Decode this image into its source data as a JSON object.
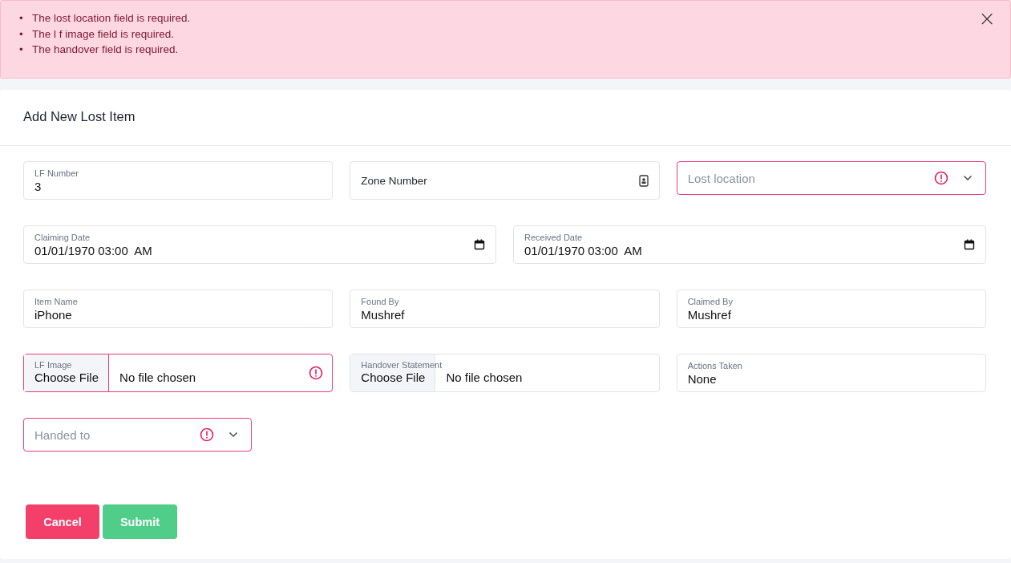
{
  "alert": {
    "messages": [
      {
        "bullet": "•",
        "text": "The lost location field is required."
      },
      {
        "bullet": "•",
        "text": "The l f image field is required."
      },
      {
        "bullet": "•",
        "text": "The handover field is required."
      }
    ],
    "close": "×"
  },
  "form": {
    "title": "Add New Lost Item",
    "rows": [
      [
        {
          "kind": "text",
          "label": "LF Number",
          "value": "3",
          "invalid": false
        },
        {
          "kind": "plain",
          "label": "Zone Number",
          "invalid": false
        },
        {
          "kind": "select",
          "placeholder": "Lost location",
          "invalid": true
        }
      ],
      [
        {
          "kind": "datetime",
          "label": "Claiming Date",
          "value": "01/01/1970 03:00  AM",
          "invalid": false
        },
        {
          "kind": "datetime",
          "label": "Received Date",
          "value": "01/01/1970 03:00  AM",
          "invalid": false
        }
      ],
      [
        {
          "kind": "text",
          "label": "Item Name",
          "value": "iPhone",
          "invalid": false
        },
        {
          "kind": "text",
          "label": "Found By",
          "value": "Mushref",
          "invalid": false
        },
        {
          "kind": "text",
          "label": "Claimed By",
          "value": "Mushref",
          "invalid": false
        }
      ],
      [
        {
          "kind": "file",
          "label": "LF Image",
          "button": "Choose File",
          "value": "No file chosen",
          "invalid": true
        },
        {
          "kind": "file",
          "label": "Handover Statement",
          "button": "Choose File",
          "value": "No file chosen",
          "invalid": false
        },
        {
          "kind": "text",
          "label": "Actions Taken",
          "value": "None",
          "invalid": false
        }
      ],
      [
        {
          "kind": "select",
          "placeholder": "Handed to",
          "invalid": true
        }
      ]
    ],
    "buttons": [
      {
        "kind": "cancel",
        "label": "Cancel"
      },
      {
        "kind": "submit",
        "label": "Submit"
      }
    ]
  }
}
